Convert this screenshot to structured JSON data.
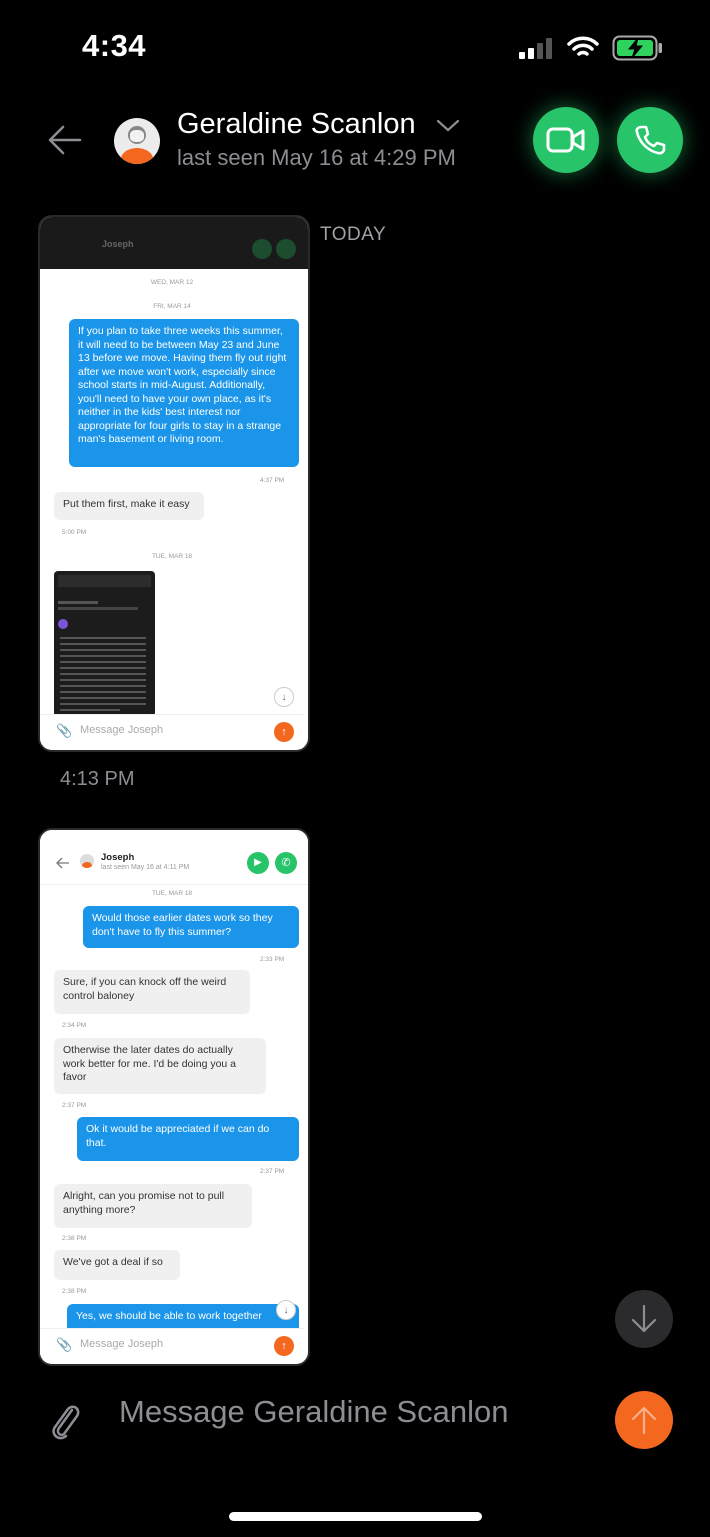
{
  "status_bar": {
    "time": "4:34"
  },
  "header": {
    "contact_name": "Geraldine Scanlon",
    "last_seen": "last seen May 16 at 4:29 PM"
  },
  "conversation": {
    "date_divider": "TODAY",
    "message_time": "4:13 PM"
  },
  "screenshot1": {
    "header_name": "Joseph",
    "dates": [
      "WED, MAR 12",
      "FRI, MAR 14",
      "TUE, MAR 18"
    ],
    "out_message": "If you plan to take three weeks this summer, it will need to be between May 23 and June 13 before we move. Having them fly out right after we move won't work, especially since school starts in mid-August. Additionally, you'll need to have your own place, as it's neither in the kids' best interest nor appropriate for four girls to stay in a strange man's basement or living room.",
    "out_time": "4:37 PM",
    "in_message": "Put them first, make it easy",
    "in_time": "5:00 PM",
    "placeholder": "Message Joseph"
  },
  "screenshot2": {
    "header_name": "Joseph",
    "header_sub": "last seen May 16 at 4:11 PM",
    "date": "TUE, MAR 18",
    "messages": [
      {
        "dir": "out",
        "text": "Would those earlier dates work so they don't have to fly this summer?",
        "time": "2:33 PM"
      },
      {
        "dir": "in",
        "text": "Sure, if you can knock off the weird control baloney",
        "time": "2:34 PM"
      },
      {
        "dir": "in",
        "text": "Otherwise the later dates do actually work better for me. I'd be doing you a favor",
        "time": "2:37 PM"
      },
      {
        "dir": "out",
        "text": "Ok it would be appreciated if we can do that.",
        "time": "2:37 PM"
      },
      {
        "dir": "in",
        "text": "Alright, can you promise not to pull anything more?",
        "time": "2:38 PM"
      },
      {
        "dir": "in",
        "text": "We've got a deal if so",
        "time": "2:38 PM"
      },
      {
        "dir": "out",
        "text": "Yes, we should be able to work together",
        "time": ""
      }
    ],
    "placeholder": "Message Joseph"
  },
  "composer": {
    "placeholder": "Message Geraldine Scanlon"
  },
  "colors": {
    "accent_green": "#27c46a",
    "send_orange": "#f4671f",
    "bubble_blue": "#1a95e9"
  },
  "icons": [
    "back-arrow-icon",
    "video-icon",
    "phone-icon",
    "paperclip-icon",
    "send-arrow-icon",
    "scroll-down-icon"
  ]
}
